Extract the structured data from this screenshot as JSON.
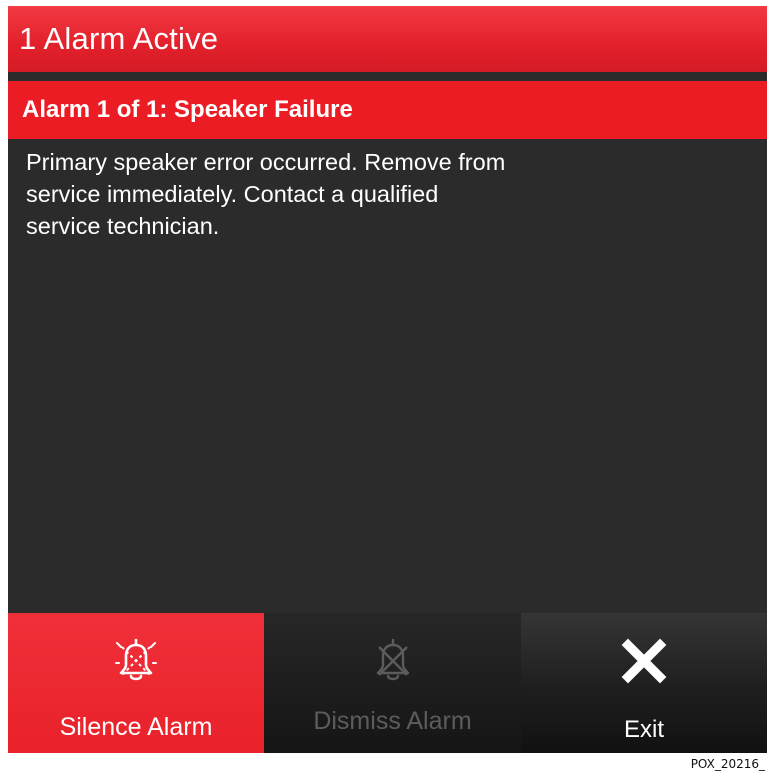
{
  "title_bar": {
    "title": "1 Alarm Active"
  },
  "alarm": {
    "header": "Alarm 1 of 1: Speaker Failure",
    "message_lines": [
      "Primary speaker error occurred. Remove from",
      "service immediately. Contact a qualified",
      "service technician."
    ]
  },
  "footer": {
    "silence": {
      "label": "Silence Alarm",
      "icon": "bell-silence-icon",
      "enabled": true
    },
    "dismiss": {
      "label": "Dismiss Alarm",
      "icon": "bell-dismiss-icon",
      "enabled": false
    },
    "exit": {
      "label": "Exit",
      "icon": "close-icon",
      "enabled": true
    }
  },
  "figure_id": "POX_20216_",
  "colors": {
    "alarm_red": "#ec1c24",
    "screen_background": "#2b2b2b",
    "disabled_text": "#5c5c5c"
  }
}
